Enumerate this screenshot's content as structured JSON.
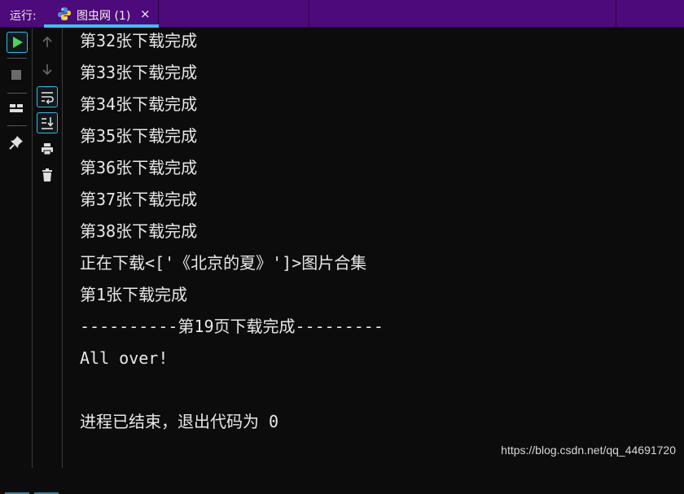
{
  "run_panel": {
    "label": "运行:",
    "tab": {
      "icon": "python-icon",
      "title": "图虫网 (1)",
      "close_glyph": "×"
    }
  },
  "toolbar": {
    "left": [
      "run-icon",
      "stop-icon",
      "layout-icon",
      "pin-icon"
    ],
    "right": [
      "arrow-up-icon",
      "arrow-down-icon",
      "soft-wrap-icon",
      "scroll-to-end-icon",
      "print-icon",
      "trash-icon"
    ]
  },
  "console": {
    "lines": [
      "第32张下载完成",
      "第33张下载完成",
      "第34张下载完成",
      "第35张下载完成",
      "第36张下载完成",
      "第37张下载完成",
      "第38张下载完成",
      "正在下载<['《北京的夏》']>图片合集",
      "第1张下载完成",
      "----------第19页下载完成---------",
      "All over!",
      "",
      "进程已结束，退出代码为 0"
    ]
  },
  "watermark": "https://blog.csdn.net/qq_44691720",
  "colors": {
    "header": "#4d0a7a",
    "accent": "#31c6f0",
    "run_green": "#4fd35a",
    "background": "#0c0c0c"
  }
}
